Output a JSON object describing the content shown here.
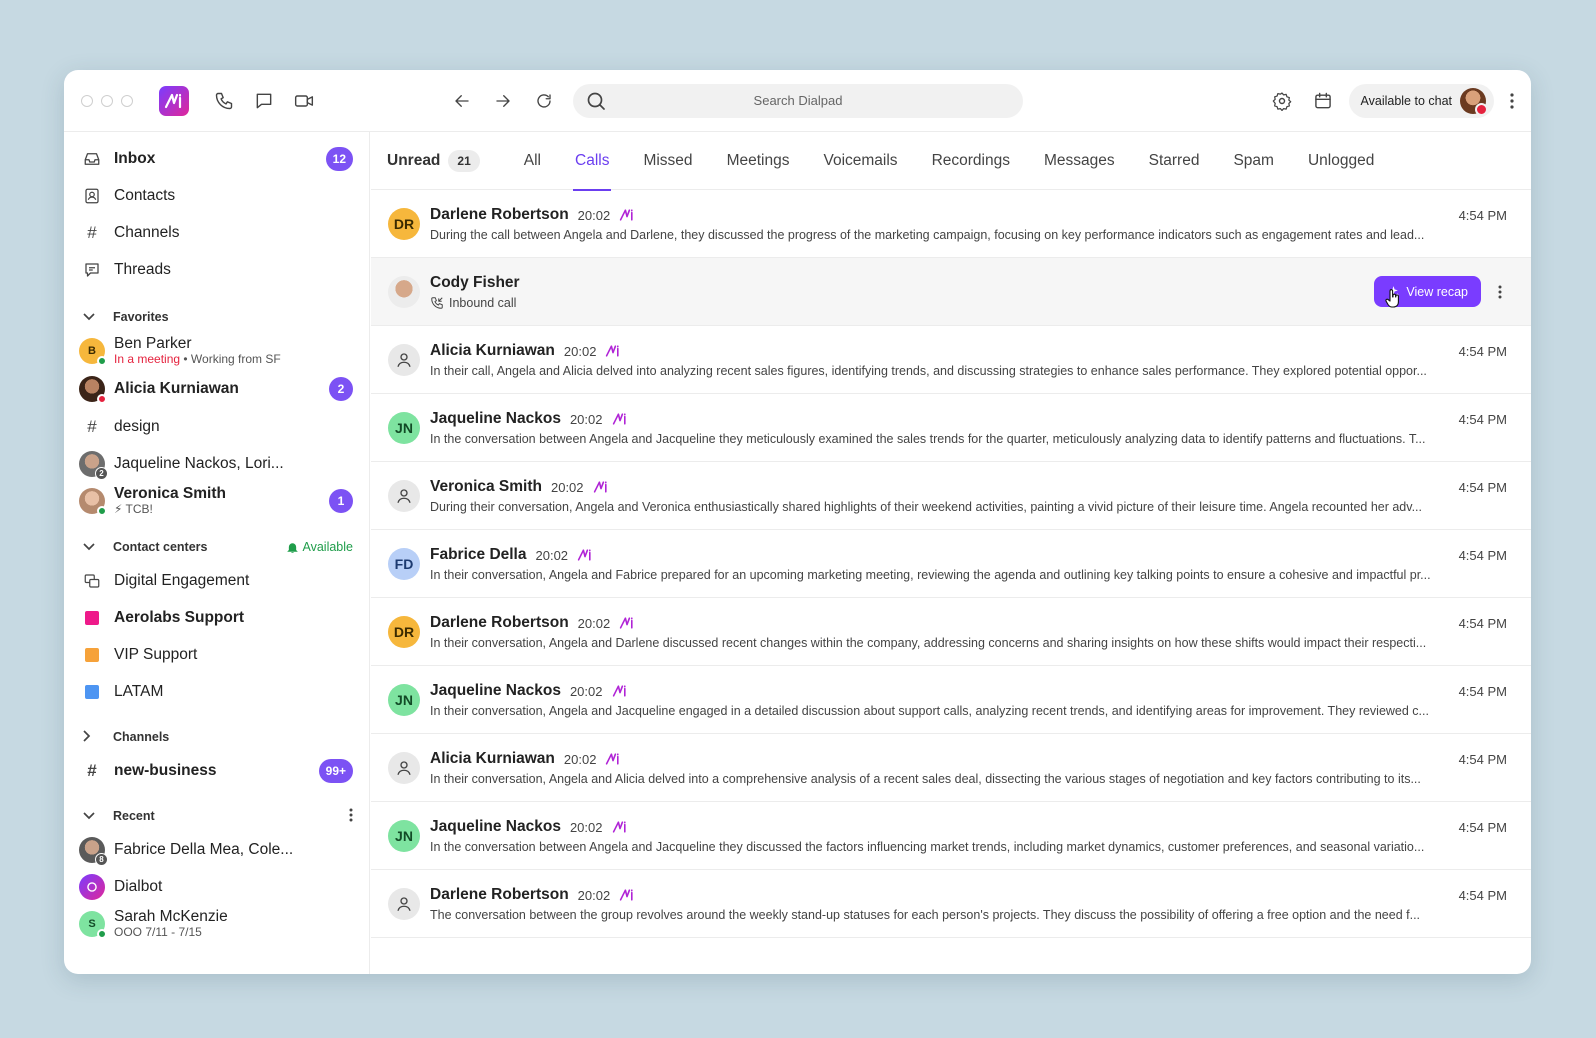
{
  "topbar": {
    "search_placeholder": "Search Dialpad",
    "status_label": "Available to chat"
  },
  "sidebar": {
    "main": [
      {
        "label": "Inbox",
        "badge": "12",
        "icon": "inbox-icon"
      },
      {
        "label": "Contacts",
        "icon": "contacts-icon"
      },
      {
        "label": "Channels",
        "icon": "hash-icon"
      },
      {
        "label": "Threads",
        "icon": "threads-icon"
      }
    ],
    "favorites": {
      "title": "Favorites",
      "ben": {
        "initial": "B",
        "name": "Ben Parker",
        "status": "In a meeting",
        "note": "Working from SF"
      },
      "alicia": {
        "name": "Alicia Kurniawan",
        "badge": "2"
      },
      "design": {
        "name": "design"
      },
      "jaqueline": {
        "name": "Jaqueline Nackos, Lori...",
        "count": "2"
      },
      "veronica": {
        "name": "Veronica Smith",
        "note": "⚡ TCB!",
        "badge": "1"
      }
    },
    "contact_centers": {
      "title": "Contact centers",
      "status": "Available",
      "items": [
        {
          "label": "Digital Engagement"
        },
        {
          "label": "Aerolabs Support",
          "color": "#ee1a8a"
        },
        {
          "label": "VIP Support",
          "color": "#f6a23a"
        },
        {
          "label": "LATAM",
          "color": "#4d95f2"
        }
      ]
    },
    "channels": {
      "title": "Channels",
      "item": {
        "label": "new-business",
        "badge": "99+"
      }
    },
    "recent": {
      "title": "Recent",
      "fabrice": {
        "name": "Fabrice Della Mea, Cole...",
        "count": "8"
      },
      "dialbot": {
        "name": "Dialbot"
      },
      "sarah": {
        "initial": "S",
        "name": "Sarah McKenzie",
        "note": "OOO 7/11 - 7/15"
      }
    }
  },
  "tabs": {
    "unread_label": "Unread",
    "unread_count": "21",
    "items": [
      "All",
      "Calls",
      "Missed",
      "Meetings",
      "Voicemails",
      "Recordings",
      "Messages",
      "Starred",
      "Spam",
      "Unlogged"
    ],
    "active": "Calls"
  },
  "calls": [
    {
      "initials": "DR",
      "avatar_color": "#f6b73c",
      "name": "Darlene Robertson",
      "duration": "20:02",
      "time": "4:54 PM",
      "summary": "During the call between Angela and Darlene, they discussed the progress of the marketing campaign, focusing on key performance indicators such as engagement rates and lead..."
    },
    {
      "name": "Cody Fisher",
      "sub": "Inbound call",
      "button": "View recap"
    },
    {
      "initials": "",
      "avatar_color": "#e8e8e8",
      "name": "Alicia Kurniawan",
      "duration": "20:02",
      "time": "4:54 PM",
      "summary": "In their call, Angela and Alicia delved into analyzing recent sales figures, identifying trends, and discussing strategies to enhance sales performance. They explored potential oppor..."
    },
    {
      "initials": "JN",
      "avatar_color": "#7ee3a0",
      "name": "Jaqueline Nackos",
      "duration": "20:02",
      "time": "4:54 PM",
      "summary": "In the conversation between Angela and Jacqueline they meticulously examined the sales trends for the quarter, meticulously analyzing data to identify patterns and fluctuations. T..."
    },
    {
      "initials": "",
      "avatar_color": "#e8e8e8",
      "name": "Veronica Smith",
      "duration": "20:02",
      "time": "4:54 PM",
      "summary": "During their conversation, Angela and Veronica enthusiastically shared highlights of their weekend activities, painting a vivid picture of their leisure time. Angela recounted her adv..."
    },
    {
      "initials": "FD",
      "avatar_color": "#b8cff7",
      "name": "Fabrice Della",
      "duration": "20:02",
      "time": "4:54 PM",
      "summary": "In their conversation, Angela and Fabrice prepared for an upcoming marketing meeting, reviewing the agenda and outlining key talking points to ensure a cohesive and impactful pr..."
    },
    {
      "initials": "DR",
      "avatar_color": "#f6b73c",
      "name": "Darlene Robertson",
      "duration": "20:02",
      "time": "4:54 PM",
      "summary": "In their conversation, Angela and Darlene discussed recent changes within the company, addressing concerns and sharing insights on how these shifts would impact their respecti..."
    },
    {
      "initials": "JN",
      "avatar_color": "#7ee3a0",
      "name": "Jaqueline Nackos",
      "duration": "20:02",
      "time": "4:54 PM",
      "summary": "In their conversation, Angela and Jacqueline engaged in a detailed discussion about support calls, analyzing recent trends, and identifying areas for improvement. They reviewed c..."
    },
    {
      "initials": "",
      "avatar_color": "#e8e8e8",
      "name": "Alicia Kurniawan",
      "duration": "20:02",
      "time": "4:54 PM",
      "summary": "In their conversation, Angela and Alicia delved into a comprehensive analysis of a recent sales deal, dissecting the various stages of negotiation and key factors contributing to its..."
    },
    {
      "initials": "JN",
      "avatar_color": "#7ee3a0",
      "name": "Jaqueline Nackos",
      "duration": "20:02",
      "time": "4:54 PM",
      "summary": "In the conversation between Angela and Jacqueline they discussed the factors influencing market trends, including market dynamics, customer preferences, and seasonal variatio..."
    },
    {
      "initials": "",
      "avatar_color": "#e8e8e8",
      "name": "Darlene Robertson",
      "duration": "20:02",
      "time": "4:54 PM",
      "summary": "The conversation between the group revolves around the weekly stand-up statuses for each person's projects. They discuss the possibility of offering a free option and the need f..."
    }
  ],
  "colors": {
    "accent": "#6b3ef0",
    "badge": "#7c52f4",
    "online": "#1f9d4a",
    "busy": "#e5223e"
  }
}
